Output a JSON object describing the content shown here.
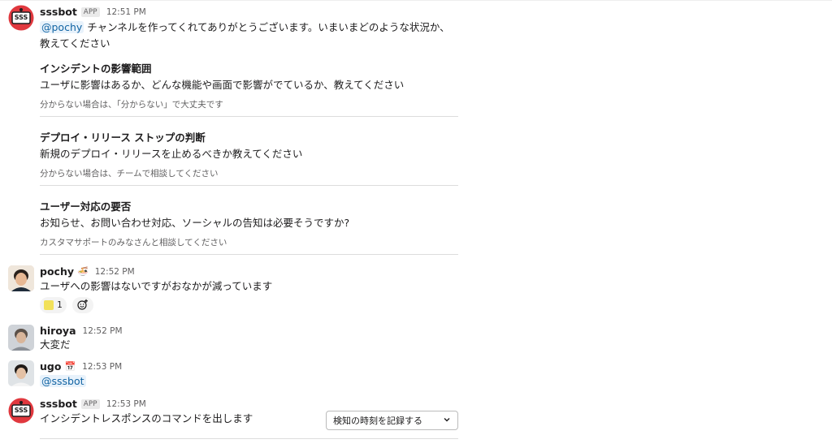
{
  "messages": [
    {
      "user": "sssbot",
      "app_badge": "APP",
      "time": "12:51 PM",
      "mention": "@pochy",
      "text_line1": " チャンネルを作ってくれてありがとうございます。いまいまどのような状況か、",
      "text_line2": "教えてください",
      "avatar_text": "SSS"
    },
    {
      "user": "pochy",
      "emoji": "🍜",
      "time": "12:52 PM",
      "text": "ユーザへの影響はないですがおなかが減っています",
      "reaction_count": "1"
    },
    {
      "user": "hiroya",
      "time": "12:52 PM",
      "text": "大変だ"
    },
    {
      "user": "ugo",
      "emoji": "📅",
      "time": "12:53 PM",
      "mention": "@sssbot"
    },
    {
      "user": "sssbot",
      "app_badge": "APP",
      "time": "12:53 PM",
      "text": "インシデントレスポンスのコマンドを出します",
      "avatar_text": "SSS",
      "dropdown_label": "検知の時刻を記録する"
    }
  ],
  "sections": [
    {
      "title": "インシデントの影響範囲",
      "body": "ユーザに影響はあるか、どんな機能や画面で影響がでているか、教えてください",
      "context": "分からない場合は、「分からない」で大丈夫です"
    },
    {
      "title": "デプロイ・リリース ストップの判断",
      "body": "新規のデプロイ・リリースを止めるべきか教えてください",
      "context": "分からない場合は、チームで相談してください"
    },
    {
      "title": "ユーザー対応の要否",
      "body": "お知らせ、お問い合わせ対応、ソーシャルの告知は必要そうですか?",
      "context": "カスタマサポートのみなさんと相談してください"
    }
  ],
  "icons": {
    "bot_avatar": "sssbot-avatar-icon",
    "add_reaction": "add-reaction-icon",
    "dropdown": "chevron-down-icon"
  },
  "colors": {
    "link": "#1264a3",
    "bot_red": "#e0383e"
  }
}
